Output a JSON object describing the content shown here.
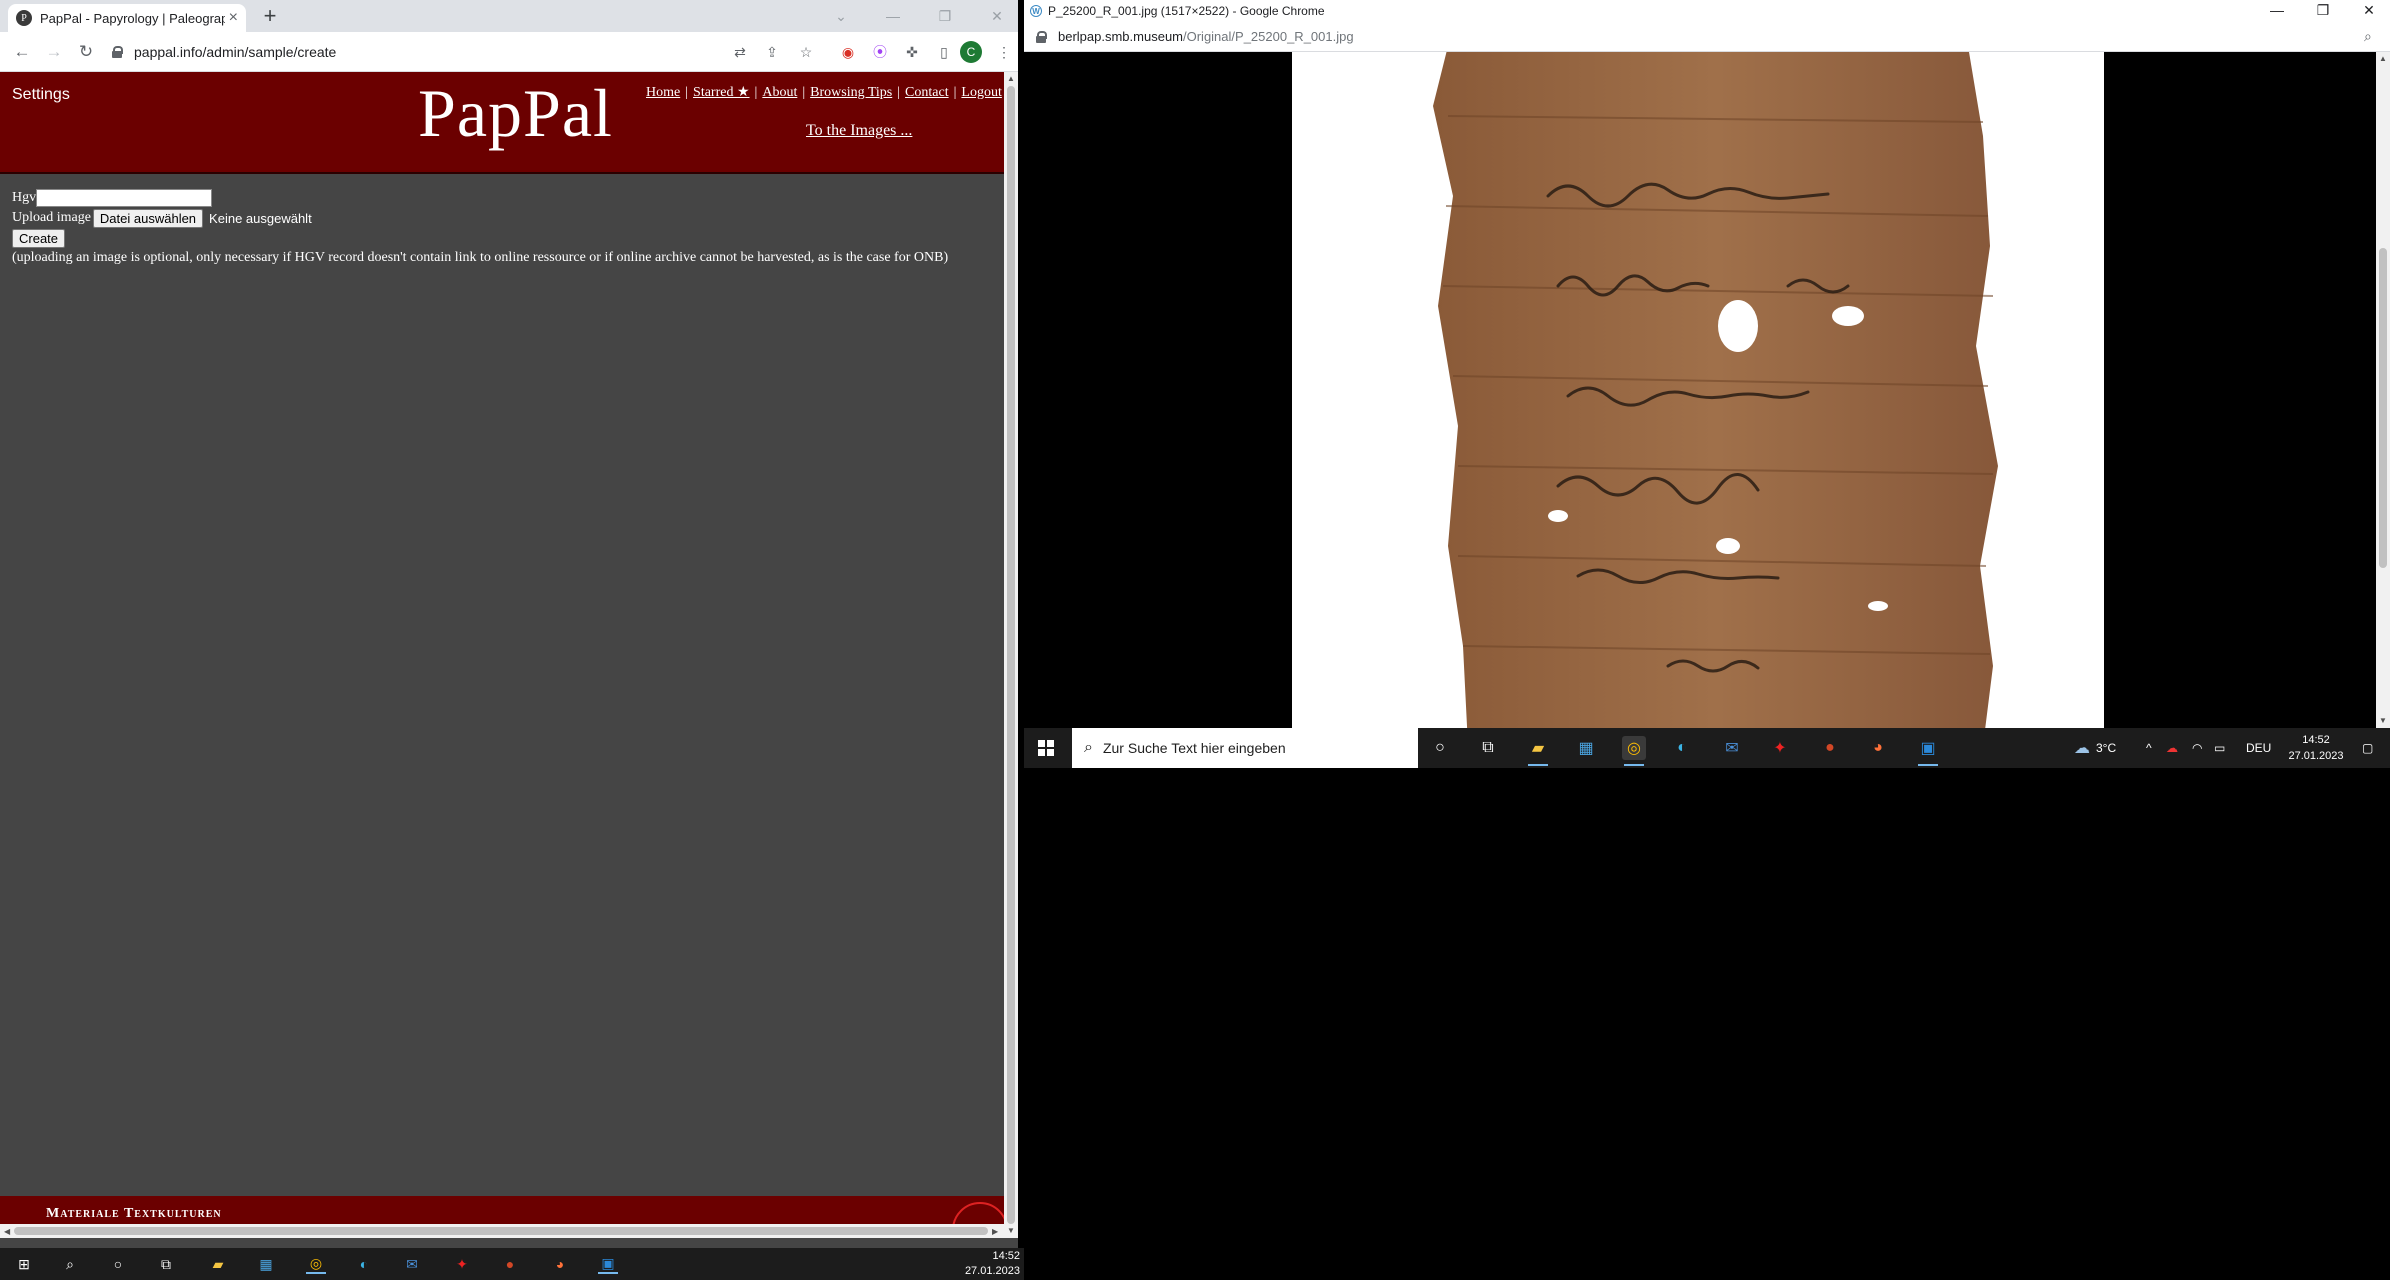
{
  "left_browser": {
    "tab_title": "PapPal - Papyrology | Paleograph",
    "tab_favicon": "P",
    "new_tab_symbol": "+",
    "url": "pappal.info/admin/sample/create",
    "profile_initial": "C"
  },
  "site": {
    "settings_label": "Settings",
    "logo": "PapPal",
    "nav": [
      "Home",
      "Starred ★",
      "About",
      "Browsing Tips",
      "Contact",
      "Logout"
    ],
    "nav_separator": "|",
    "to_images": "To the Images ...",
    "form": {
      "hgv_label": "Hgv",
      "hgv_value": "",
      "upload_label": "Upload image",
      "file_button": "Datei auswählen",
      "file_none": "Keine ausgewählt",
      "create_button": "Create",
      "note": "(uploading an image is optional, only necessary if HGV record doesn't contain link to online ressource or if online archive cannot be harvested, as is the case for ONB)"
    },
    "footer_text": "Materiale Textkulturen"
  },
  "left_taskbar": {
    "time": "14:52",
    "date": "27.01.2023"
  },
  "right_browser": {
    "title": "P_25200_R_001.jpg (1517×2522) - Google Chrome",
    "url_host": "berlpap.smb.museum",
    "url_path": "/Original/P_25200_R_001.jpg"
  },
  "right_taskbar": {
    "search_placeholder": "Zur Suche Text hier eingeben",
    "weather": "3°C",
    "language": "DEU",
    "time": "14:52",
    "date": "27.01.2023"
  },
  "icons": {
    "browser_accent": "#1a73e8",
    "header_color": "#6b0000",
    "page_bg": "#454545"
  }
}
